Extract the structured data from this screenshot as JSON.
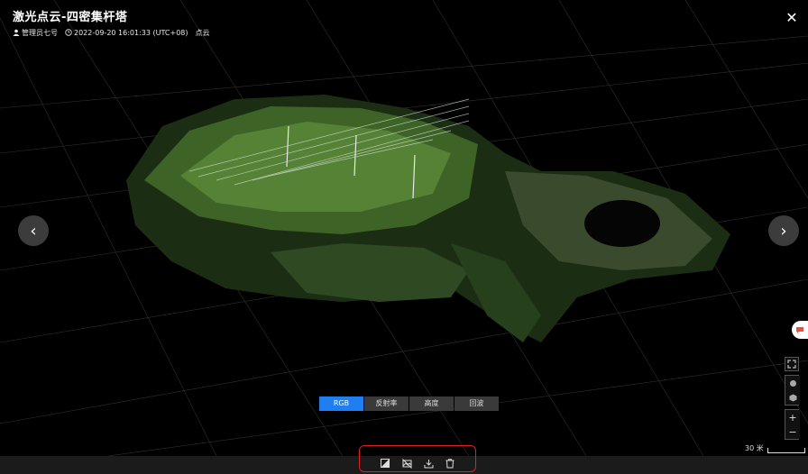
{
  "header": {
    "title": "激光点云-四密集杆塔",
    "operator": "管理员七号",
    "timestamp": "2022-09-20 16:01:33 (UTC+08)",
    "type": "点云"
  },
  "modes": {
    "items": [
      "RGB",
      "反射率",
      "高度",
      "回波"
    ],
    "active": "RGB"
  },
  "scale": {
    "label": "30 米"
  },
  "icons": {
    "close": "close-icon",
    "prev": "chevron-left-icon",
    "next": "chevron-right-icon",
    "feedback": "chat-icon",
    "fullscreen": "fullscreen-icon",
    "view_top": "view-top-icon",
    "view_side": "view-side-icon",
    "zoom_in": "plus-icon",
    "zoom_out": "minus-icon",
    "actions": [
      "compare-icon",
      "image-off-icon",
      "download-icon",
      "delete-icon"
    ]
  },
  "colors": {
    "accent": "#1f7ff0",
    "highlight_border": "#dd2222",
    "background": "#000000"
  }
}
